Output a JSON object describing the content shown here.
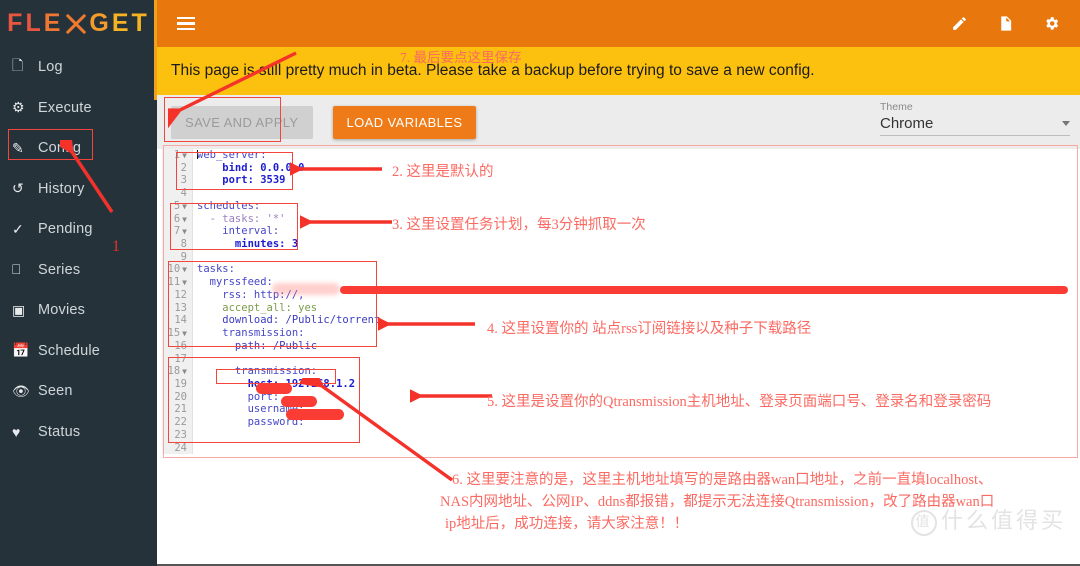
{
  "app": {
    "brand_parts": [
      "FLE",
      "GET"
    ],
    "brand_full": "FLEXGET",
    "brand_colors": {
      "red": "#e8563f",
      "orange": "#ef7733",
      "amber": "#f5b323"
    },
    "header_bg": "#e8770d",
    "banner_bg": "#fcc00f",
    "toolbar_bg": "#ececec",
    "sidebar_bg": "#26323a",
    "annotation_color": "#fb6a62"
  },
  "sidebar": {
    "items": [
      {
        "label": "Log",
        "icon": "document-icon"
      },
      {
        "label": "Execute",
        "icon": "gear-icon"
      },
      {
        "label": "Config",
        "icon": "pencil-icon"
      },
      {
        "label": "History",
        "icon": "history-icon"
      },
      {
        "label": "Pending",
        "icon": "check-icon"
      },
      {
        "label": "Series",
        "icon": "monitor-icon"
      },
      {
        "label": "Movies",
        "icon": "film-icon"
      },
      {
        "label": "Schedule",
        "icon": "calendar-icon"
      },
      {
        "label": "Seen",
        "icon": "eye-icon"
      },
      {
        "label": "Status",
        "icon": "heartbeat-icon"
      }
    ],
    "active": "Config"
  },
  "header": {
    "menu_icon": "hamburger-icon",
    "icons": [
      {
        "name": "pencil-icon"
      },
      {
        "name": "document-icon"
      },
      {
        "name": "gear-icon"
      }
    ]
  },
  "banner": {
    "text": "This page is still pretty much in beta. Please take a backup before trying to save a new config."
  },
  "toolbar": {
    "save_label": "SAVE AND APPLY",
    "save_disabled": true,
    "load_variables_label": "LOAD VARIABLES",
    "theme": {
      "label": "Theme",
      "value": "Chrome",
      "caret": "chevron-down-icon"
    }
  },
  "editor": {
    "line_numbers": [
      "1",
      "2",
      "3",
      "4",
      "5",
      "6",
      "7",
      "8",
      "9",
      "10",
      "11",
      "12",
      "13",
      "14",
      "15",
      "16",
      "17",
      "18",
      "19",
      "20",
      "21",
      "22",
      "23",
      "24"
    ],
    "fold_lines": [
      "1",
      "5",
      "6",
      "7",
      "10",
      "11",
      "15",
      "18"
    ],
    "lines": [
      {
        "n": "1",
        "text": "web_server:"
      },
      {
        "n": "2",
        "text": "    bind: 0.0.0.0"
      },
      {
        "n": "3",
        "text": "    port: 3539"
      },
      {
        "n": "4",
        "text": ""
      },
      {
        "n": "5",
        "text": "schedules:"
      },
      {
        "n": "6",
        "text": "  - tasks: '*'"
      },
      {
        "n": "7",
        "text": "    interval:"
      },
      {
        "n": "8",
        "text": "      minutes: 3"
      },
      {
        "n": "9",
        "text": ""
      },
      {
        "n": "10",
        "text": "tasks:"
      },
      {
        "n": "11",
        "text": "  myrssfeed:"
      },
      {
        "n": "12",
        "text": "    rss: http://,"
      },
      {
        "n": "13",
        "text": "    accept_all: yes"
      },
      {
        "n": "14",
        "text": "    download: /Public/torrent"
      },
      {
        "n": "15",
        "text": "    transmission:"
      },
      {
        "n": "16",
        "text": "      path: /Public"
      },
      {
        "n": "17",
        "text": ""
      },
      {
        "n": "18",
        "text": "      transmission:"
      },
      {
        "n": "19",
        "text": "        host: 192.168.1.2"
      },
      {
        "n": "20",
        "text": "        port:"
      },
      {
        "n": "21",
        "text": "        username:"
      },
      {
        "n": "22",
        "text": "        password: \""
      },
      {
        "n": "23",
        "text": ""
      },
      {
        "n": "24",
        "text": ""
      }
    ]
  },
  "annotations": {
    "n1": "1",
    "n2": "2. 这里是默认的",
    "n3": "3. 这里设置任务计划，每3分钟抓取一次",
    "n4": "4. 这里设置你的  站点rss订阅链接以及种子下载路径",
    "n5": "5. 这里是设置你的Qtransmission主机地址、登录页面端口号、登录名和登录密码",
    "n6_line1": "6. 这里要注意的是，这里主机地址填写的是路由器wan口地址，之前一直填localhost、",
    "n6_line2": "NAS内网地址、公网IP、ddns都报错，都提示无法连接Qtransmission，改了路由器wan口",
    "n6_line3": "ip地址后，成功连接，请大家注意！！",
    "n7": "7. 最后要点这里保存"
  },
  "watermark": {
    "badge": "值",
    "text": "什么值得买"
  }
}
